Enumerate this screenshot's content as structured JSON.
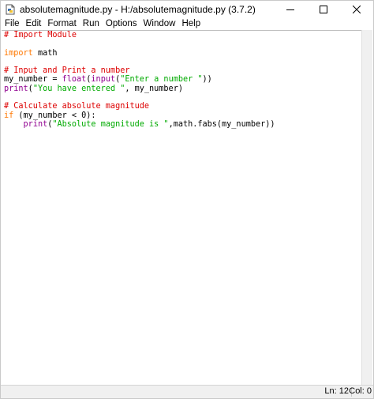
{
  "window": {
    "title": "absolutemagnitude.py - H:/absolutemagnitude.py (3.7.2)"
  },
  "menu": {
    "items": [
      "File",
      "Edit",
      "Format",
      "Run",
      "Options",
      "Window",
      "Help"
    ]
  },
  "editor": {
    "lines": [
      [
        {
          "t": "comment",
          "v": "# Import Module"
        }
      ],
      [],
      [
        {
          "t": "keyword",
          "v": "import"
        },
        {
          "t": "plain",
          "v": " math"
        }
      ],
      [],
      [
        {
          "t": "comment",
          "v": "# Input and Print a number"
        }
      ],
      [
        {
          "t": "plain",
          "v": "my_number = "
        },
        {
          "t": "builtin",
          "v": "float"
        },
        {
          "t": "plain",
          "v": "("
        },
        {
          "t": "builtin",
          "v": "input"
        },
        {
          "t": "plain",
          "v": "("
        },
        {
          "t": "string",
          "v": "\"Enter a number \""
        },
        {
          "t": "plain",
          "v": "))"
        }
      ],
      [
        {
          "t": "builtin",
          "v": "print"
        },
        {
          "t": "plain",
          "v": "("
        },
        {
          "t": "string",
          "v": "\"You have entered \""
        },
        {
          "t": "plain",
          "v": ", my_number)"
        }
      ],
      [],
      [
        {
          "t": "comment",
          "v": "# Calculate absolute magnitude"
        }
      ],
      [
        {
          "t": "keyword",
          "v": "if"
        },
        {
          "t": "plain",
          "v": " (my_number < 0):"
        }
      ],
      [
        {
          "t": "plain",
          "v": "    "
        },
        {
          "t": "builtin",
          "v": "print"
        },
        {
          "t": "plain",
          "v": "("
        },
        {
          "t": "string",
          "v": "\"Absolute magnitude is \""
        },
        {
          "t": "plain",
          "v": ",math.fabs(my_number))"
        }
      ]
    ]
  },
  "status": {
    "line": "Ln: 12",
    "col": "Col: 0"
  },
  "colors": {
    "comment": "#dd0000",
    "keyword": "#ff7700",
    "builtin": "#900090",
    "string": "#00aa00"
  }
}
